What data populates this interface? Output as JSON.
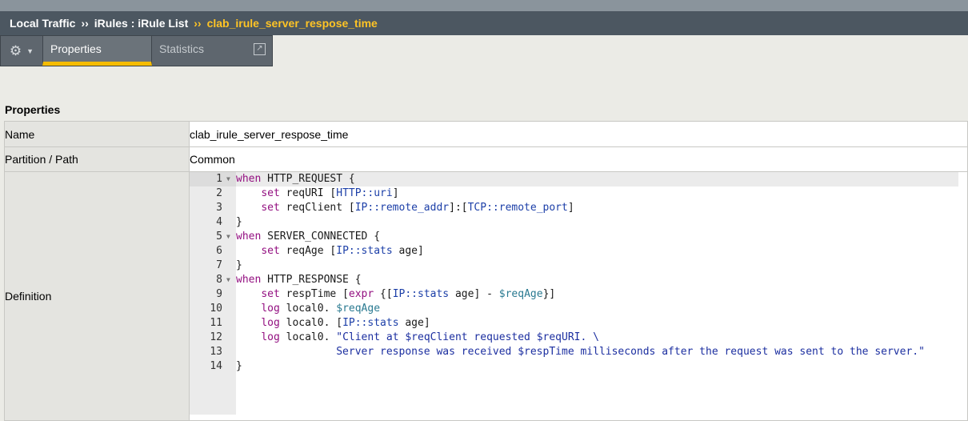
{
  "breadcrumb": {
    "item1": "Local Traffic",
    "sep": "››",
    "item2": "iRules : iRule List",
    "current": "clab_irule_server_respose_time"
  },
  "tabs": {
    "gear_icon": "gear-icon",
    "chevron": "▼",
    "properties": "Properties",
    "statistics": "Statistics",
    "popout_icon": "external-link-icon"
  },
  "section_title": "Properties",
  "properties": {
    "name_label": "Name",
    "name_value": "clab_irule_server_respose_time",
    "partition_label": "Partition / Path",
    "partition_value": "Common",
    "definition_label": "Definition"
  },
  "code_lines": [
    {
      "num": "1",
      "fold": true,
      "tokens": [
        [
          "kw",
          "when"
        ],
        [
          "nm",
          " HTTP_REQUEST {"
        ]
      ]
    },
    {
      "num": "2",
      "fold": false,
      "tokens": [
        [
          "nm",
          "    "
        ],
        [
          "kw",
          "set"
        ],
        [
          "nm",
          " reqURI ["
        ],
        [
          "ns",
          "HTTP::uri"
        ],
        [
          "nm",
          "]"
        ]
      ]
    },
    {
      "num": "3",
      "fold": false,
      "tokens": [
        [
          "nm",
          "    "
        ],
        [
          "kw",
          "set"
        ],
        [
          "nm",
          " reqClient ["
        ],
        [
          "ns",
          "IP::remote_addr"
        ],
        [
          "nm",
          "]:["
        ],
        [
          "ns",
          "TCP::remote_port"
        ],
        [
          "nm",
          "]"
        ]
      ]
    },
    {
      "num": "4",
      "fold": false,
      "tokens": [
        [
          "nm",
          "}"
        ]
      ]
    },
    {
      "num": "5",
      "fold": true,
      "tokens": [
        [
          "kw",
          "when"
        ],
        [
          "nm",
          " SERVER_CONNECTED {"
        ]
      ]
    },
    {
      "num": "6",
      "fold": false,
      "tokens": [
        [
          "nm",
          "    "
        ],
        [
          "kw",
          "set"
        ],
        [
          "nm",
          " reqAge ["
        ],
        [
          "ns",
          "IP::stats"
        ],
        [
          "nm",
          " age]"
        ]
      ]
    },
    {
      "num": "7",
      "fold": false,
      "tokens": [
        [
          "nm",
          "}"
        ]
      ]
    },
    {
      "num": "8",
      "fold": true,
      "tokens": [
        [
          "kw",
          "when"
        ],
        [
          "nm",
          " HTTP_RESPONSE {"
        ]
      ]
    },
    {
      "num": "9",
      "fold": false,
      "tokens": [
        [
          "nm",
          "    "
        ],
        [
          "kw",
          "set"
        ],
        [
          "nm",
          " respTime ["
        ],
        [
          "kw",
          "expr"
        ],
        [
          "nm",
          " {["
        ],
        [
          "ns",
          "IP::stats"
        ],
        [
          "nm",
          " age] - "
        ],
        [
          "var",
          "$reqAge"
        ],
        [
          "nm",
          "}]"
        ]
      ]
    },
    {
      "num": "10",
      "fold": false,
      "tokens": [
        [
          "nm",
          "    "
        ],
        [
          "kw",
          "log"
        ],
        [
          "nm",
          " local0. "
        ],
        [
          "var",
          "$reqAge"
        ]
      ]
    },
    {
      "num": "11",
      "fold": false,
      "tokens": [
        [
          "nm",
          "    "
        ],
        [
          "kw",
          "log"
        ],
        [
          "nm",
          " local0. ["
        ],
        [
          "ns",
          "IP::stats"
        ],
        [
          "nm",
          " age]"
        ]
      ]
    },
    {
      "num": "12",
      "fold": false,
      "tokens": [
        [
          "nm",
          "    "
        ],
        [
          "kw",
          "log"
        ],
        [
          "nm",
          " local0. "
        ],
        [
          "str",
          "\"Client at $reqClient requested $reqURI. \\"
        ]
      ]
    },
    {
      "num": "13",
      "fold": false,
      "tokens": [
        [
          "str",
          "                Server response was received $respTime milliseconds after the request was sent to the server.\""
        ]
      ]
    },
    {
      "num": "14",
      "fold": false,
      "tokens": [
        [
          "nm",
          "}"
        ]
      ]
    }
  ],
  "colors": {
    "breadcrumb_bg": "#4c5761",
    "current_accent": "#ffc425",
    "tab_underline": "#f5bc00",
    "keyword": "#930f80",
    "namespace": "#1c3fa8",
    "variable": "#2a7a91",
    "string": "#1c2fa0"
  }
}
